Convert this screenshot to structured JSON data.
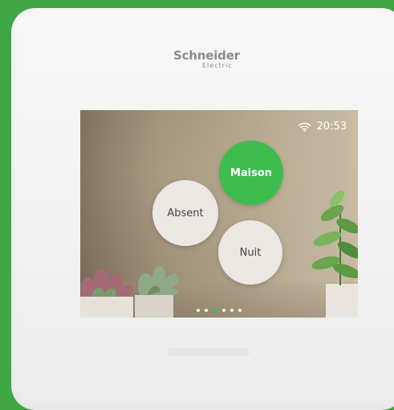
{
  "brand": {
    "name": "Schneider",
    "sub": "Electric"
  },
  "status": {
    "time": "20:53",
    "wifi_icon": "wifi-icon"
  },
  "modes": [
    {
      "label": "Maison",
      "active": true
    },
    {
      "label": "Absent",
      "active": false
    },
    {
      "label": "Nuit",
      "active": false
    }
  ],
  "pager": {
    "pages": 6,
    "current": 3
  },
  "colors": {
    "accent": "#3cbc4c",
    "frame": "#3fa845",
    "bubble": "#ebe8e3"
  }
}
